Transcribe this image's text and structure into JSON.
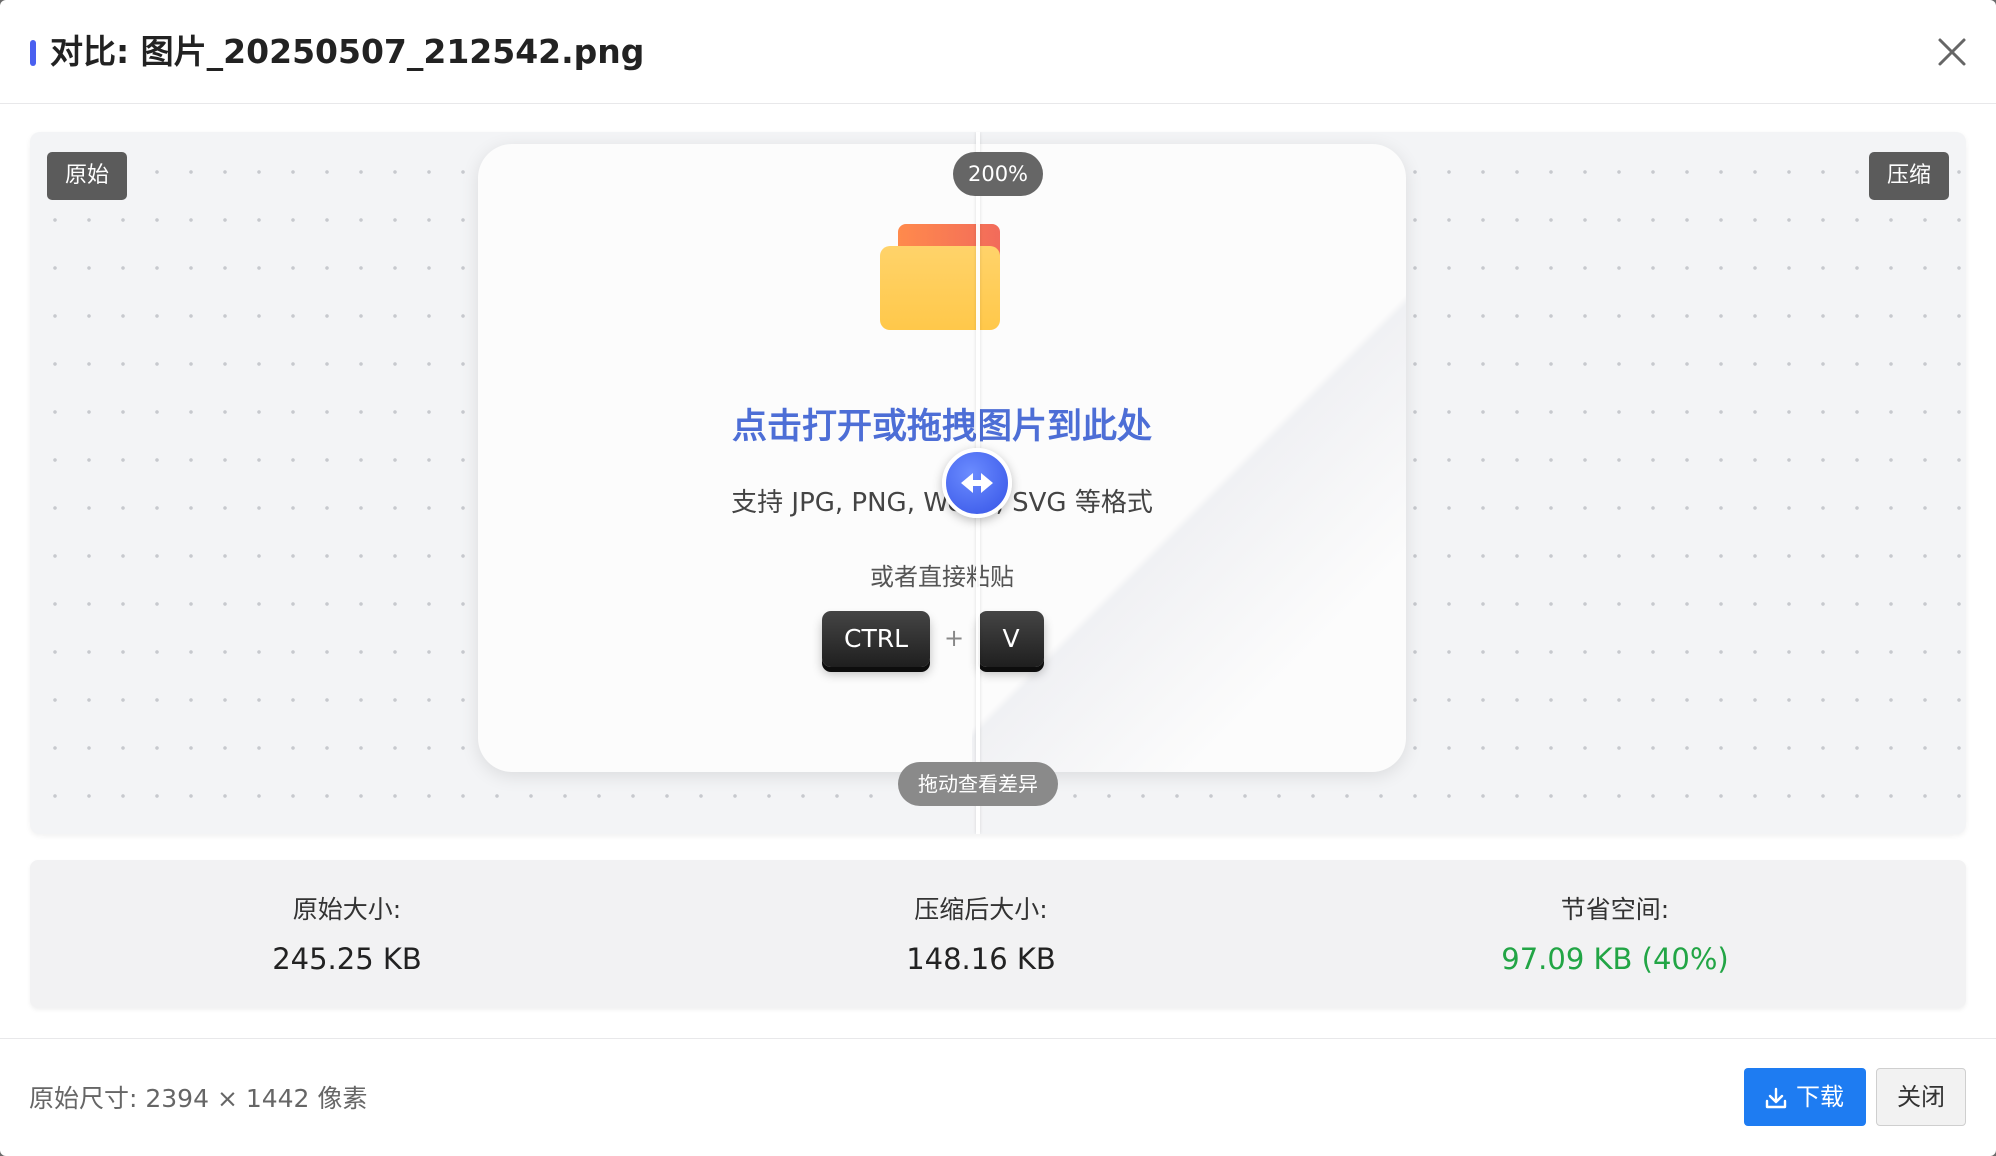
{
  "dialog": {
    "title": "对比: 图片_20250507_212542.png",
    "close_icon": "close-icon"
  },
  "compare": {
    "left_tag": "原始",
    "right_tag": "压缩",
    "zoom": "200%",
    "drag_hint": "拖动查看差异",
    "handle_icon": "arrows-left-right-icon"
  },
  "dropzone": {
    "icon": "folder-icon",
    "title": "点击打开或拖拽图片到此处",
    "subtitle": "支持 JPG, PNG, WebP, SVG 等格式",
    "or_text": "或者直接粘贴",
    "key1": "CTRL",
    "plus": "+",
    "key2": "V"
  },
  "stats": {
    "original_label": "原始大小:",
    "original_value": "245.25 KB",
    "compressed_label": "压缩后大小:",
    "compressed_value": "148.16 KB",
    "saved_label": "节省空间:",
    "saved_value": "97.09 KB (40%)",
    "saved_color": "#22a545"
  },
  "footer": {
    "dimensions": "原始尺寸: 2394 × 1442 像素",
    "download_label": "下载",
    "download_icon": "download-icon",
    "close_label": "关闭"
  },
  "colors": {
    "accent": "#4a60f0",
    "primary_button": "#1e7cf2",
    "drop_title": "#4d6ed6"
  }
}
